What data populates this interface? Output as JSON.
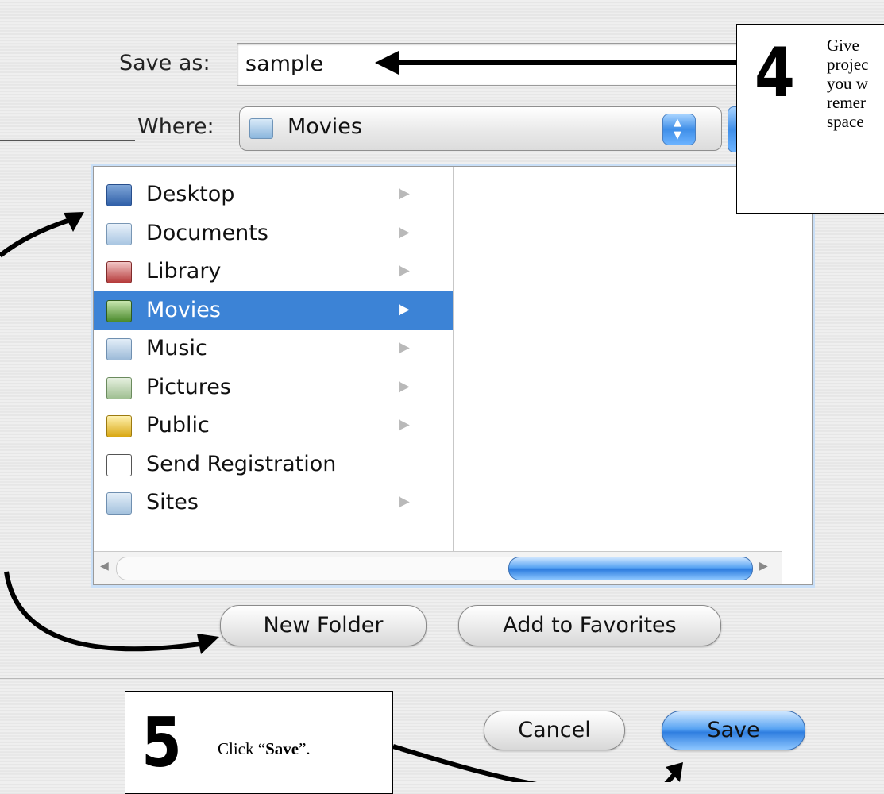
{
  "dialog": {
    "save_as_label": "Save as:",
    "save_as_value": "sample",
    "where_label": "Where:",
    "where_value": "Movies"
  },
  "browser": {
    "items": [
      {
        "label": "Desktop",
        "icon": "desktop-icon",
        "arrow": "▶"
      },
      {
        "label": "Documents",
        "icon": "folder-icon",
        "arrow": "▶"
      },
      {
        "label": "Library",
        "icon": "library-folder-icon",
        "arrow": "▶"
      },
      {
        "label": "Movies",
        "icon": "movies-folder-icon",
        "arrow": "▶"
      },
      {
        "label": "Music",
        "icon": "music-folder-icon",
        "arrow": "▶"
      },
      {
        "label": "Pictures",
        "icon": "pictures-folder-icon",
        "arrow": "▶"
      },
      {
        "label": "Public",
        "icon": "public-folder-icon",
        "arrow": "▶"
      },
      {
        "label": "Send Registration",
        "icon": "document-alias-icon",
        "arrow": ""
      },
      {
        "label": "Sites",
        "icon": "sites-folder-icon",
        "arrow": "▶"
      }
    ],
    "selected": "Movies"
  },
  "buttons": {
    "new_folder": "New Folder",
    "add_to_favorites": "Add to Favorites",
    "cancel": "Cancel",
    "save": "Save"
  },
  "callouts": {
    "step4": {
      "number": "4",
      "lines": [
        "Give",
        "projec",
        "you w",
        "remer",
        "space"
      ]
    },
    "step5": {
      "number": "5",
      "text_prefix": "Click “",
      "text_bold": "Save",
      "text_suffix": "”."
    }
  },
  "colors": {
    "selection": "#3c83d6",
    "default_button": "#4a97ef"
  }
}
